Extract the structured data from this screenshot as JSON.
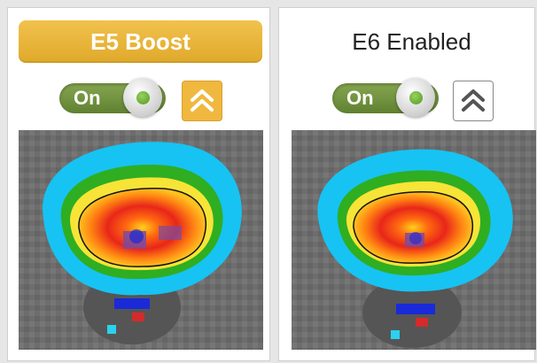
{
  "panels": [
    {
      "id": "e5",
      "title": "E5 Boost",
      "title_style": "highlighted",
      "toggle": {
        "label": "On",
        "state": "on"
      },
      "boost_button": {
        "icon": "double-chevron-up-icon",
        "state": "active"
      },
      "heatmap": {
        "icon": "signal-coverage-heatmap"
      }
    },
    {
      "id": "e6",
      "title": "E6 Enabled",
      "title_style": "plain",
      "toggle": {
        "label": "On",
        "state": "on"
      },
      "boost_button": {
        "icon": "double-chevron-up-icon",
        "state": "inactive"
      },
      "heatmap": {
        "icon": "signal-coverage-heatmap"
      }
    }
  ],
  "colors": {
    "accent": "#e8b93c",
    "toggle_on": "#6f9140",
    "heat_core": "#e02418",
    "heat_mid": "#ff9a00",
    "heat_edge": "#11c7f0",
    "heat_ring_green": "#2fae21",
    "background_noise": "#6f6f6f"
  }
}
